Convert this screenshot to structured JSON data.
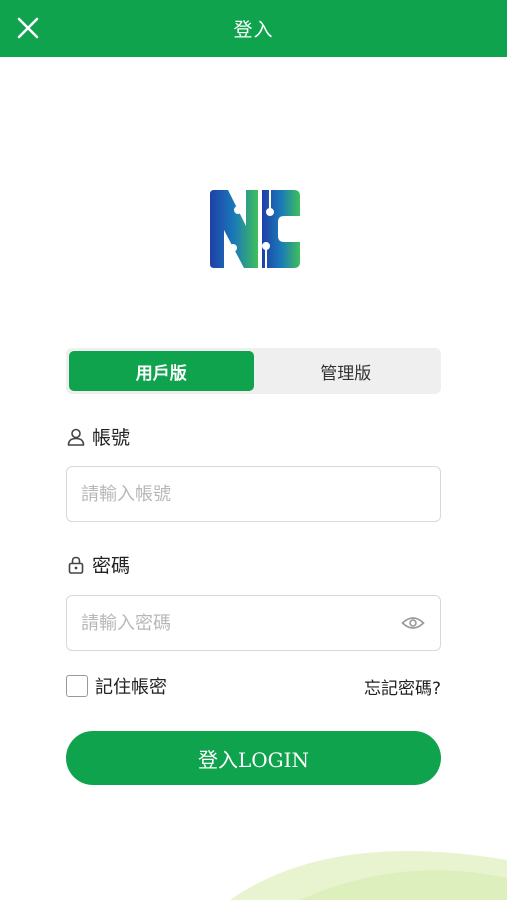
{
  "header": {
    "title": "登入",
    "close_icon": "close-icon"
  },
  "tabs": [
    {
      "label": "用戶版",
      "active": true
    },
    {
      "label": "管理版",
      "active": false
    }
  ],
  "account": {
    "label": "帳號",
    "icon": "user-icon",
    "value": "",
    "placeholder": "請輸入帳號"
  },
  "password": {
    "label": "密碼",
    "icon": "lock-icon",
    "value": "",
    "placeholder": "請輸入密碼",
    "toggle_icon": "eye-icon"
  },
  "remember": {
    "label": "記住帳密",
    "checked": false
  },
  "forgot_label": "忘記密碼?",
  "login_label": "登入LOGIN",
  "colors": {
    "primary": "#0ea34c",
    "tab_bg": "#efefef",
    "input_border": "#d9d9d9",
    "placeholder": "#b8b8b8",
    "wave_light": "#e8f3cf"
  }
}
